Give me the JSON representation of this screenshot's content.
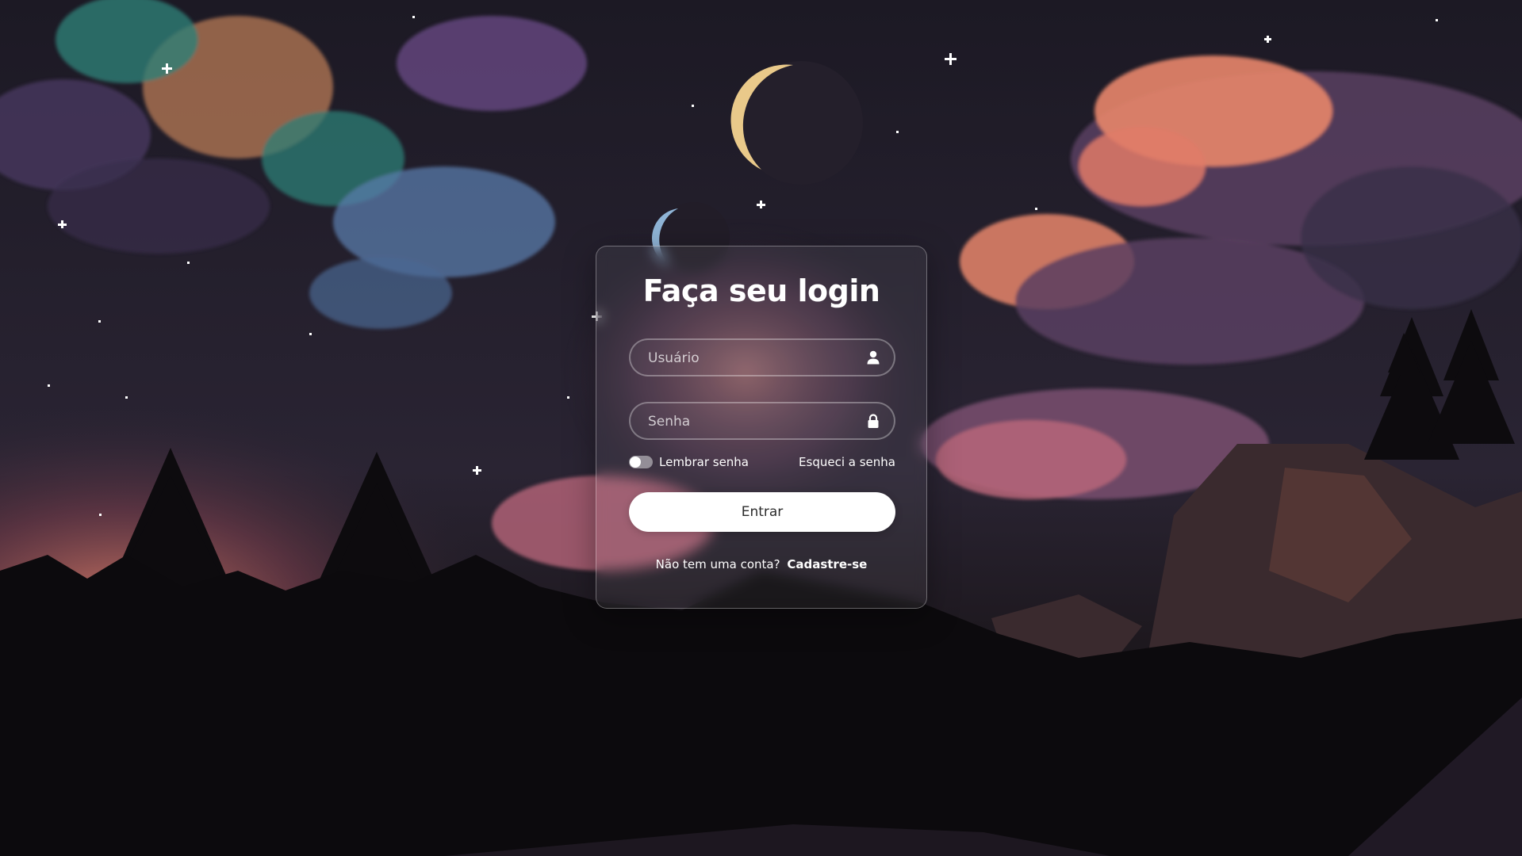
{
  "login": {
    "title": "Faça seu login",
    "username_placeholder": "Usuário",
    "password_placeholder": "Senha",
    "remember_label": "Lembrar senha",
    "remember_checked": false,
    "forgot_label": "Esqueci a senha",
    "submit_label": "Entrar",
    "register_prompt": "Não tem uma conta?",
    "register_label": "Cadastre-se"
  },
  "icons": {
    "username": "user-icon",
    "password": "lock-icon"
  },
  "colors": {
    "sky_dark": "#1b1824",
    "sky_mid": "#2c2636",
    "cloud_orange": "#e8866b",
    "cloud_pink": "#b8667a",
    "cloud_purple": "#6a4a86",
    "nebula_teal": "#2f8a7e",
    "nebula_blue": "#5f86b8",
    "forest": "#0d0b0e",
    "button_bg": "#ffffff",
    "button_text": "#2b2b2b"
  }
}
